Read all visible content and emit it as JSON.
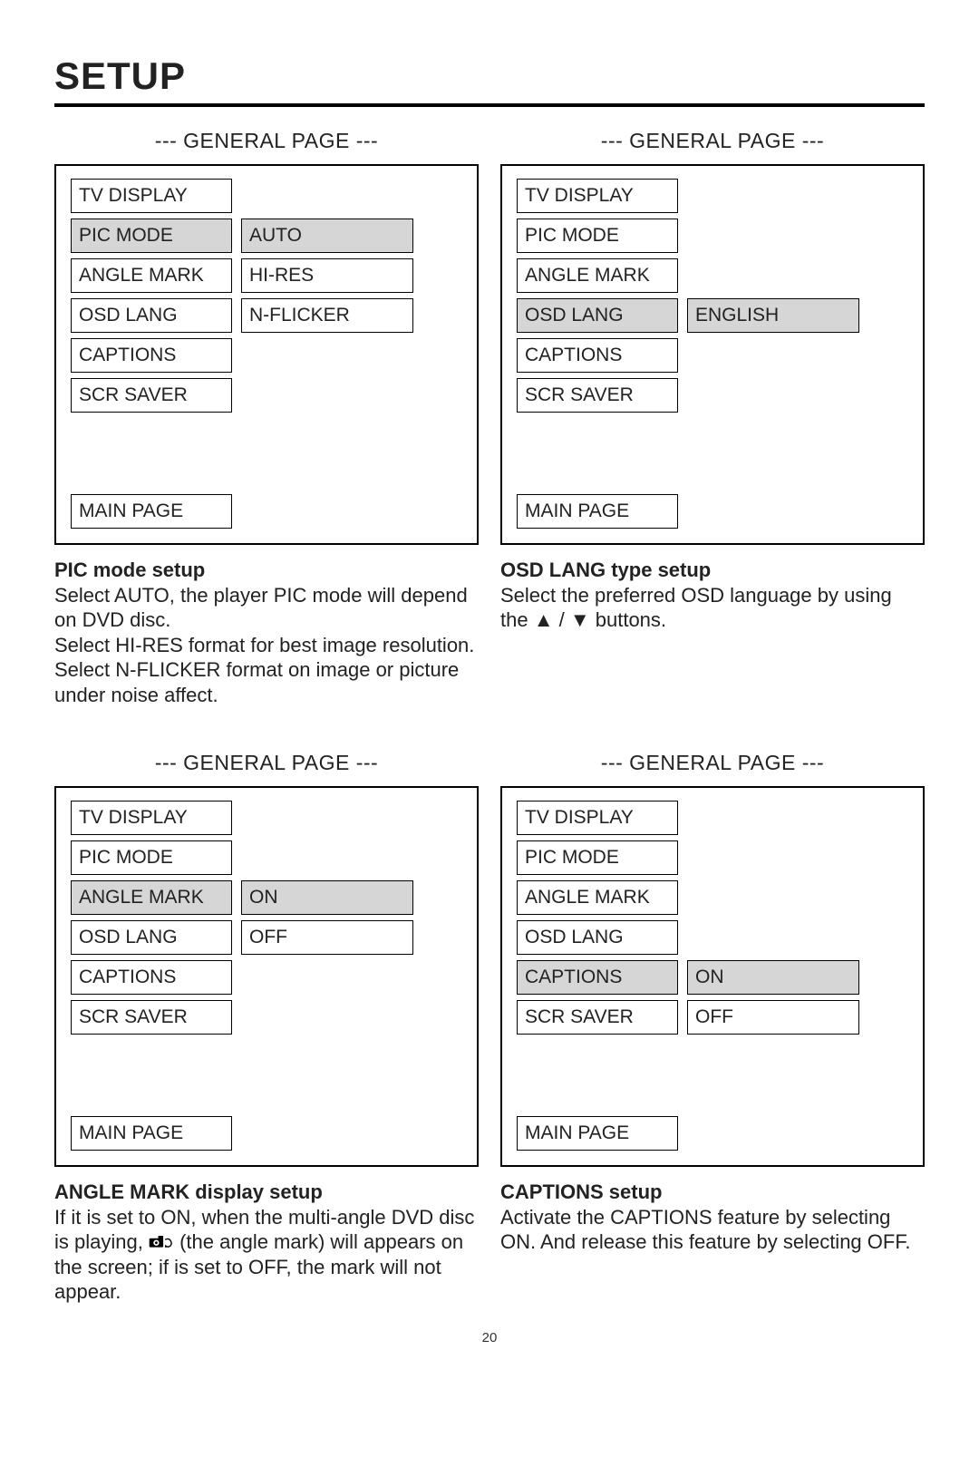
{
  "page_title": "SETUP",
  "page_number": "20",
  "menu_header": "--- GENERAL PAGE ---",
  "left_items": [
    "TV DISPLAY",
    "PIC MODE",
    "ANGLE MARK",
    "OSD LANG",
    "CAPTIONS",
    "SCR SAVER"
  ],
  "main_page": "MAIN PAGE",
  "panels": {
    "pic": {
      "selected_index": 1,
      "options": [
        "AUTO",
        "HI-RES",
        "N-FLICKER"
      ],
      "options_start": 1,
      "selected_option": 0,
      "desc_title": "PIC mode setup",
      "desc_lines": [
        "Select AUTO, the player PIC mode will depend on DVD disc.",
        "Select HI-RES format for best image resolution.",
        "Select N-FLICKER format on image or picture under noise affect."
      ]
    },
    "osd": {
      "selected_index": 3,
      "options": [
        "ENGLISH"
      ],
      "options_start": 3,
      "selected_option": 0,
      "desc_title": "OSD LANG type setup",
      "desc_pre": "Select the preferred OSD language by using the",
      "desc_post": "buttons."
    },
    "angle": {
      "selected_index": 2,
      "options": [
        "ON",
        "OFF"
      ],
      "options_start": 2,
      "selected_option": 0,
      "desc_title": "ANGLE MARK display setup",
      "desc_pre": "If it is set to ON, when the multi-angle DVD disc is playing,",
      "desc_mid": "(the angle mark) will appears on the screen; if is set to OFF, the mark will not appear."
    },
    "captions": {
      "selected_index": 4,
      "options": [
        "ON",
        "OFF"
      ],
      "options_start": 4,
      "selected_option": 0,
      "desc_title": "CAPTIONS setup",
      "desc_lines": [
        "Activate the CAPTIONS feature by selecting ON.  And release this feature by selecting OFF."
      ]
    }
  }
}
